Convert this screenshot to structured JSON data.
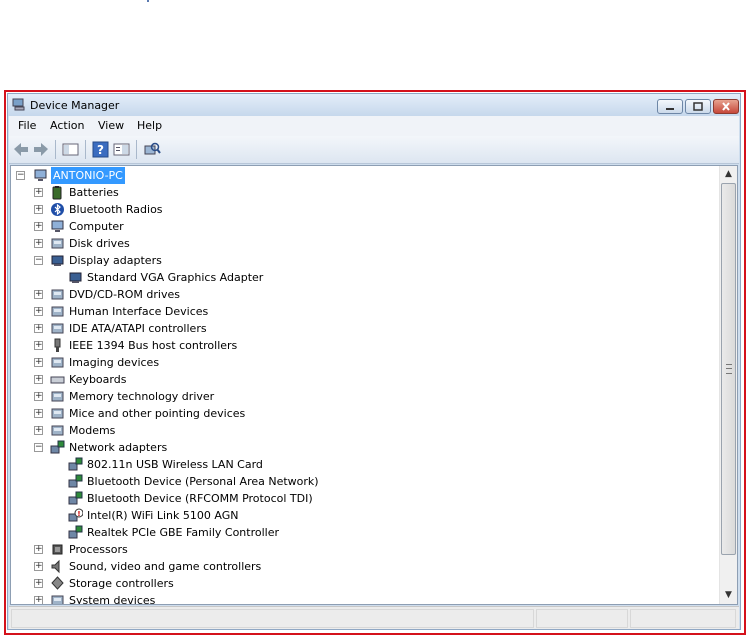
{
  "window": {
    "title": "Device Manager"
  },
  "menu": [
    "File",
    "Action",
    "View",
    "Help"
  ],
  "tree": {
    "root": "ANTONIO-PC",
    "items": [
      {
        "label": "Batteries",
        "level": 1,
        "state": "plus",
        "icon": "battery-icon"
      },
      {
        "label": "Bluetooth Radios",
        "level": 1,
        "state": "plus",
        "icon": "bluetooth-icon"
      },
      {
        "label": "Computer",
        "level": 1,
        "state": "plus",
        "icon": "computer-icon"
      },
      {
        "label": "Disk drives",
        "level": 1,
        "state": "plus",
        "icon": "disk-drive-icon"
      },
      {
        "label": "Display adapters",
        "level": 1,
        "state": "minus",
        "icon": "display-adapter-icon"
      },
      {
        "label": "Standard VGA Graphics Adapter",
        "level": 2,
        "state": "none",
        "icon": "display-adapter-icon"
      },
      {
        "label": "DVD/CD-ROM drives",
        "level": 1,
        "state": "plus",
        "icon": "dvd-drive-icon"
      },
      {
        "label": "Human Interface Devices",
        "level": 1,
        "state": "plus",
        "icon": "hid-icon"
      },
      {
        "label": "IDE ATA/ATAPI controllers",
        "level": 1,
        "state": "plus",
        "icon": "ide-controller-icon"
      },
      {
        "label": "IEEE 1394 Bus host controllers",
        "level": 1,
        "state": "plus",
        "icon": "ieee1394-icon"
      },
      {
        "label": "Imaging devices",
        "level": 1,
        "state": "plus",
        "icon": "imaging-device-icon"
      },
      {
        "label": "Keyboards",
        "level": 1,
        "state": "plus",
        "icon": "keyboard-icon"
      },
      {
        "label": "Memory technology driver",
        "level": 1,
        "state": "plus",
        "icon": "memory-icon"
      },
      {
        "label": "Mice and other pointing devices",
        "level": 1,
        "state": "plus",
        "icon": "mouse-icon"
      },
      {
        "label": "Modems",
        "level": 1,
        "state": "plus",
        "icon": "modem-icon"
      },
      {
        "label": "Network adapters",
        "level": 1,
        "state": "minus",
        "icon": "network-adapter-icon"
      },
      {
        "label": "802.11n USB Wireless LAN Card",
        "level": 2,
        "state": "none",
        "icon": "network-adapter-icon"
      },
      {
        "label": "Bluetooth Device (Personal Area Network)",
        "level": 2,
        "state": "none",
        "icon": "network-adapter-icon"
      },
      {
        "label": "Bluetooth Device (RFCOMM Protocol TDI)",
        "level": 2,
        "state": "none",
        "icon": "network-adapter-icon"
      },
      {
        "label": "Intel(R) WiFi Link 5100 AGN",
        "level": 2,
        "state": "none",
        "icon": "network-adapter-warning-icon"
      },
      {
        "label": "Realtek PCIe GBE Family Controller",
        "level": 2,
        "state": "none",
        "icon": "network-adapter-icon"
      },
      {
        "label": "Processors",
        "level": 1,
        "state": "plus",
        "icon": "processor-icon"
      },
      {
        "label": "Sound, video and game controllers",
        "level": 1,
        "state": "plus",
        "icon": "sound-icon"
      },
      {
        "label": "Storage controllers",
        "level": 1,
        "state": "plus",
        "icon": "storage-controller-icon"
      },
      {
        "label": "System devices",
        "level": 1,
        "state": "plus",
        "icon": "system-device-icon"
      }
    ]
  },
  "colors": {
    "frame": "#d4111b",
    "selection": "#3399ff"
  }
}
